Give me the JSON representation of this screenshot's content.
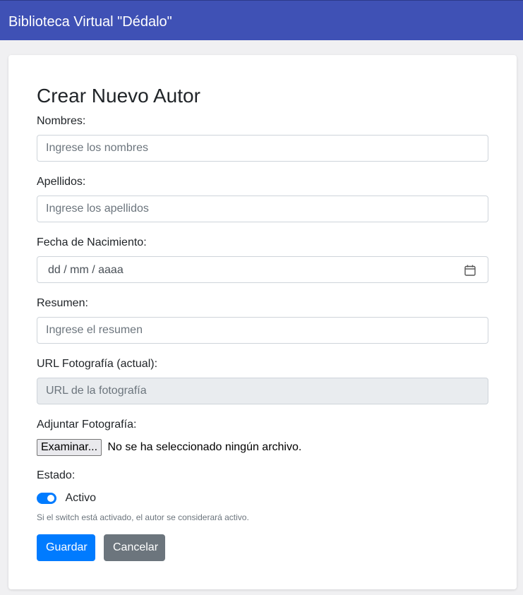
{
  "header": {
    "brand": "Biblioteca Virtual \"Dédalo\""
  },
  "form": {
    "title": "Crear Nuevo Autor",
    "nombres": {
      "label": "Nombres:",
      "placeholder": "Ingrese los nombres",
      "value": ""
    },
    "apellidos": {
      "label": "Apellidos:",
      "placeholder": "Ingrese los apellidos",
      "value": ""
    },
    "fecha_nacimiento": {
      "label": "Fecha de Nacimiento:",
      "display": "dd / mm / aaaa",
      "icon": "calendar-icon"
    },
    "resumen": {
      "label": "Resumen:",
      "placeholder": "Ingrese el resumen",
      "value": ""
    },
    "url_foto": {
      "label": "URL Fotografía (actual):",
      "placeholder": "URL de la fotografía",
      "disabled": true
    },
    "adjuntar": {
      "label": "Adjuntar Fotografía:",
      "button_label": "Examinar...",
      "status": "No se ha seleccionado ningún archivo."
    },
    "estado": {
      "label": "Estado:",
      "switch_label": "Activo",
      "checked": true,
      "help": "Si el switch está activado, el autor se considerará activo."
    },
    "buttons": {
      "guardar": "Guardar",
      "cancelar": "Cancelar"
    }
  },
  "colors": {
    "navbar": "#3f51b5",
    "primary": "#007bff",
    "secondary": "#6c757d"
  }
}
